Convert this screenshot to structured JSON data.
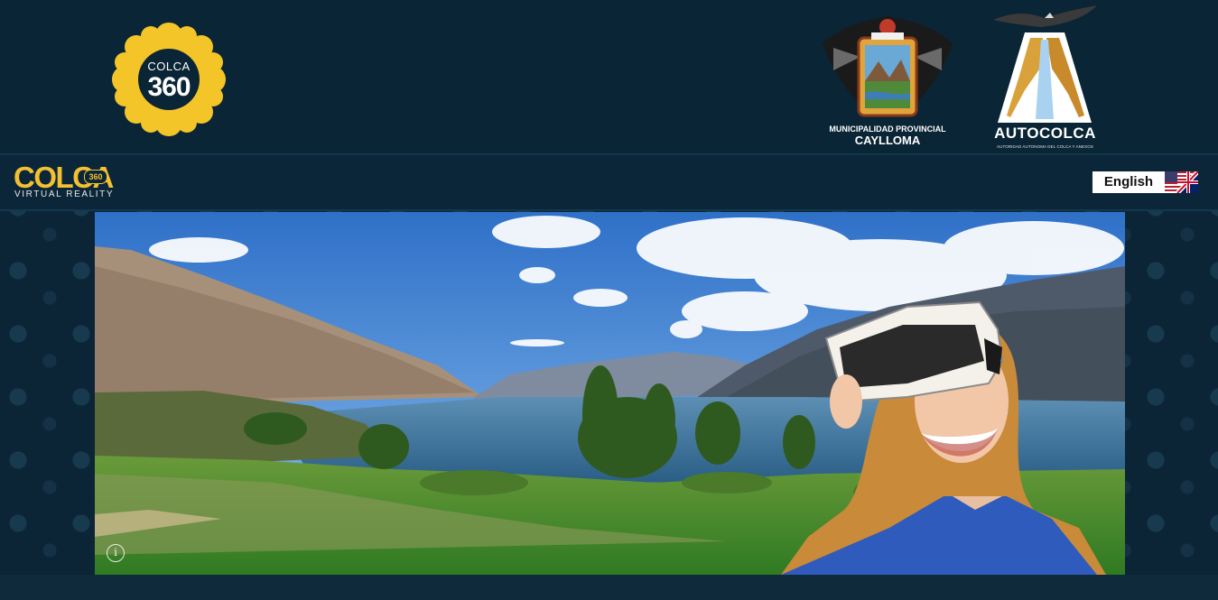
{
  "header": {
    "colca360_logo": {
      "small_text": "COLCA",
      "big_text": "360",
      "icon": "sun-flower-logo"
    },
    "municipality_crest": {
      "line1": "MUNICIPALIDAD PROVINCIAL",
      "line2": "CAYLLOMA",
      "icon": "condor-crest-icon"
    },
    "autocolca_logo": {
      "name": "AUTOCOLCA",
      "subtitle": "AUTORIDAD AUTONOMA DEL COLCA Y ANEXOS",
      "icon": "condor-canyon-icon"
    }
  },
  "nav": {
    "brand": {
      "word": "COLCA",
      "badge": "360",
      "sub": "VIRTUAL REALITY"
    },
    "language": {
      "label": "English",
      "flag_icon": "us-uk-flag-icon"
    }
  },
  "hero": {
    "info_icon": "info-icon",
    "info_glyph": "i",
    "scene": "lake-valley-vr-headset"
  },
  "colors": {
    "background": "#0a2535",
    "brand_yellow": "#f2c031",
    "sky_blue": "#3b84d6",
    "lake_blue": "#2f6f99",
    "grass_green": "#3f8a2a"
  }
}
